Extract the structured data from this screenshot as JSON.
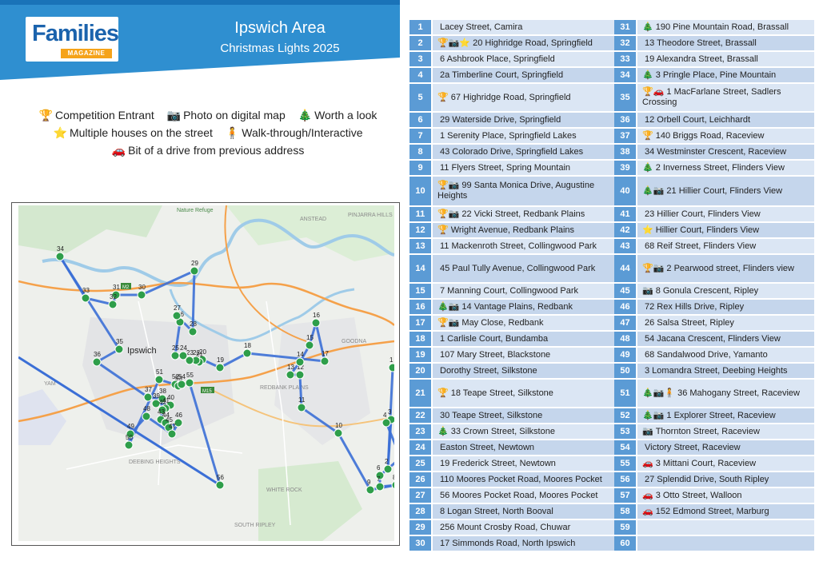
{
  "header": {
    "logo_text": "Families",
    "logo_sub": "MAGAZINE",
    "title": "Ipswich Area",
    "subtitle": "Christmas Lights 2025"
  },
  "legend": {
    "competition": {
      "icon": "🏆",
      "label": "Competition Entrant"
    },
    "photo": {
      "icon": "📷",
      "label": "Photo on digital map"
    },
    "worth_look": {
      "icon": "🎄",
      "label": "Worth a look"
    },
    "multiple": {
      "icon": "⭐",
      "label": "Multiple houses on the street"
    },
    "walkthrough": {
      "icon": "🧍",
      "label": "Walk-through/Interactive"
    },
    "drive": {
      "icon": "🚗",
      "label": "Bit of a drive from previous address"
    }
  },
  "map": {
    "place_labels": {
      "ipswich": "Ipswich",
      "redbank_plains": "REDBANK PLAINS",
      "deebing_heights": "DEEBING HEIGHTS",
      "white_rock": "WHITE ROCK",
      "goodna": "GOODNA",
      "pinjarra_hills": "PINJARRA HILLS",
      "anstead": "ANSTEAD",
      "nature_refuge": "Nature Refuge",
      "south_ripley": "SOUTH RIPLEY",
      "yamanto": "YAM",
      "m2": "M2",
      "m15": "M15"
    }
  },
  "addresses": [
    {
      "n": "1",
      "icons": "",
      "text": "Lacey Street, Camira"
    },
    {
      "n": "2",
      "icons": "🏆📷⭐",
      "text": "20 Highridge Road, Springfield"
    },
    {
      "n": "3",
      "icons": "",
      "text": "6 Ashbrook Place, Springfield"
    },
    {
      "n": "4",
      "icons": "",
      "text": "2a Timberline Court, Springfield"
    },
    {
      "n": "5",
      "icons": "🏆",
      "text": "67 Highridge Road, Springfield"
    },
    {
      "n": "6",
      "icons": "",
      "text": "29 Waterside Drive, Springfield"
    },
    {
      "n": "7",
      "icons": "",
      "text": "1 Serenity Place, Springfield Lakes"
    },
    {
      "n": "8",
      "icons": "",
      "text": "43 Colorado Drive, Springfield Lakes"
    },
    {
      "n": "9",
      "icons": "",
      "text": "11 Flyers Street, Spring Mountain"
    },
    {
      "n": "10",
      "icons": "🏆📷",
      "text": "99 Santa Monica Drive, Augustine Heights"
    },
    {
      "n": "11",
      "icons": "🏆📷",
      "text": "22 Vicki Street, Redbank Plains"
    },
    {
      "n": "12",
      "icons": "🏆",
      "text": "Wright Avenue, Redbank Plains"
    },
    {
      "n": "13",
      "icons": "",
      "text": "11 Mackenroth Street, Collingwood Park"
    },
    {
      "n": "14",
      "icons": "",
      "text": "45 Paul Tully Avenue, Collingwood Park"
    },
    {
      "n": "15",
      "icons": "",
      "text": "7 Manning Court, Collingwood Park"
    },
    {
      "n": "16",
      "icons": "🎄📷",
      "text": "14 Vantage Plains, Redbank"
    },
    {
      "n": "17",
      "icons": "🏆📷",
      "text": "May Close, Redbank"
    },
    {
      "n": "18",
      "icons": "",
      "text": "1 Carlisle Court, Bundamba"
    },
    {
      "n": "19",
      "icons": "",
      "text": "107 Mary Street, Blackstone"
    },
    {
      "n": "20",
      "icons": "",
      "text": "Dorothy Street, Silkstone"
    },
    {
      "n": "21",
      "icons": "🏆",
      "text": "18 Teape Street, Silkstone"
    },
    {
      "n": "22",
      "icons": "",
      "text": "30 Teape Street, Silkstone"
    },
    {
      "n": "23",
      "icons": "🎄",
      "text": "33 Crown Street, Silkstone"
    },
    {
      "n": "24",
      "icons": "",
      "text": "Easton Street, Newtown"
    },
    {
      "n": "25",
      "icons": "",
      "text": "19 Frederick Street, Newtown"
    },
    {
      "n": "26",
      "icons": "",
      "text": "110 Moores Pocket Road, Moores Pocket"
    },
    {
      "n": "27",
      "icons": "",
      "text": "56 Moores Pocket Road, Moores Pocket"
    },
    {
      "n": "28",
      "icons": "",
      "text": "8 Logan Street, North Booval"
    },
    {
      "n": "29",
      "icons": "",
      "text": "256 Mount Crosby Road, Chuwar"
    },
    {
      "n": "30",
      "icons": "",
      "text": "17 Simmonds Road, North Ipswich"
    },
    {
      "n": "31",
      "icons": "🎄",
      "text": "190 Pine Mountain Road, Brassall"
    },
    {
      "n": "32",
      "icons": "",
      "text": "13 Theodore Street, Brassall"
    },
    {
      "n": "33",
      "icons": "",
      "text": "19 Alexandra Street, Brassall"
    },
    {
      "n": "34",
      "icons": "🎄",
      "text": "3 Pringle Place, Pine Mountain"
    },
    {
      "n": "35",
      "icons": "🏆🚗",
      "text": "1 MacFarlane Street, Sadlers Crossing"
    },
    {
      "n": "36",
      "icons": "",
      "text": "12 Orbell Court, Leichhardt"
    },
    {
      "n": "37",
      "icons": "🏆",
      "text": "140 Briggs Road, Raceview"
    },
    {
      "n": "38",
      "icons": "",
      "text": "34 Westminster Crescent, Raceview"
    },
    {
      "n": "39",
      "icons": "🎄",
      "text": "2 Inverness Street, Flinders View"
    },
    {
      "n": "40",
      "icons": "🎄📷",
      "text": "21 Hillier Court, Flinders View"
    },
    {
      "n": "41",
      "icons": "",
      "text": "23 Hillier Court, Flinders View"
    },
    {
      "n": "42",
      "icons": "⭐",
      "text": "Hillier Court, Flinders View"
    },
    {
      "n": "43",
      "icons": "",
      "text": "68 Reif Street, Flinders View"
    },
    {
      "n": "44",
      "icons": "🏆📷",
      "text": "2 Pearwood street, Flinders view"
    },
    {
      "n": "45",
      "icons": "📷",
      "text": "8 Gonula Crescent, Ripley"
    },
    {
      "n": "46",
      "icons": "",
      "text": "72 Rex Hills Drive, Ripley"
    },
    {
      "n": "47",
      "icons": "",
      "text": "26 Salsa Street, Ripley"
    },
    {
      "n": "48",
      "icons": "",
      "text": "54 Jacana Crescent, Flinders View"
    },
    {
      "n": "49",
      "icons": "",
      "text": "68 Sandalwood Drive, Yamanto"
    },
    {
      "n": "50",
      "icons": "",
      "text": "3 Lomandra Street, Deebing Heights"
    },
    {
      "n": "51",
      "icons": "🎄📷🧍",
      "text": "36 Mahogany Street, Raceview"
    },
    {
      "n": "52",
      "icons": "🎄📷",
      "text": "1 Explorer Street, Raceview"
    },
    {
      "n": "53",
      "icons": "📷",
      "text": "Thornton Street, Raceview"
    },
    {
      "n": "54",
      "icons": "",
      "text": "Victory Street, Raceview"
    },
    {
      "n": "55",
      "icons": "🚗",
      "text": "3 Mittani Court, Raceview"
    },
    {
      "n": "56",
      "icons": "",
      "text": "27 Splendid Drive, South Ripley"
    },
    {
      "n": "57",
      "icons": "🚗",
      "text": "3 Otto Street, Walloon"
    },
    {
      "n": "58",
      "icons": "🚗",
      "text": "152 Edmond Street, Marburg"
    },
    {
      "n": "59",
      "icons": "",
      "text": ""
    },
    {
      "n": "60",
      "icons": "",
      "text": ""
    }
  ]
}
